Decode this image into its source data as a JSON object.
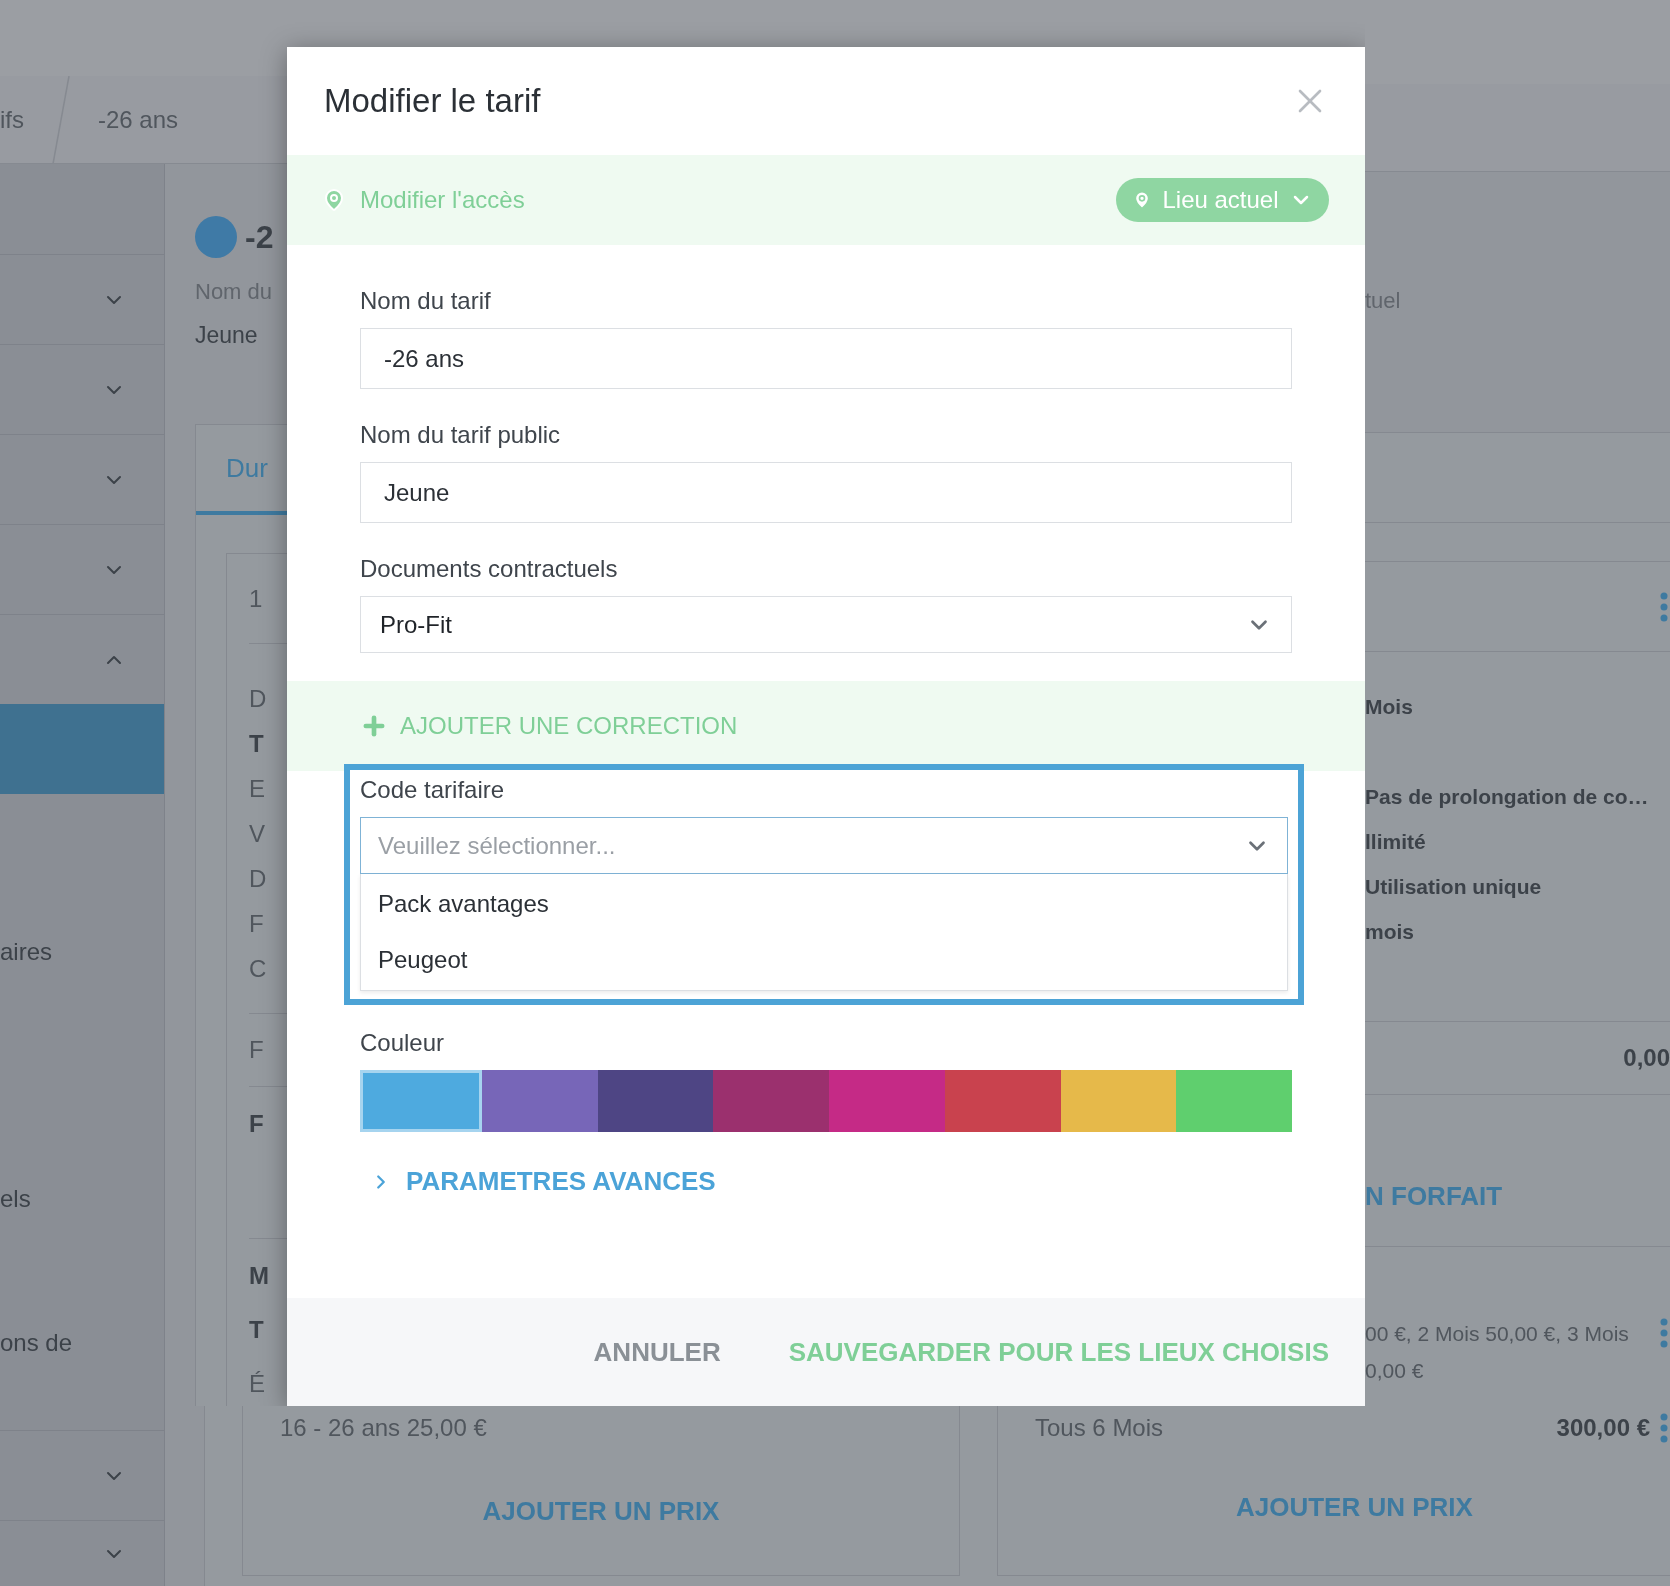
{
  "background": {
    "breadcrumb": [
      "ifs",
      "-26 ans"
    ],
    "sidebar_top": [
      {
        "kind": "group",
        "expanded": false
      },
      {
        "kind": "group",
        "expanded": false
      },
      {
        "kind": "group",
        "expanded": false
      },
      {
        "kind": "group",
        "expanded": false
      },
      {
        "kind": "group",
        "expanded": true
      },
      {
        "kind": "link",
        "selected": true
      },
      {
        "kind": "link",
        "label": "aires",
        "selected": false
      },
      {
        "kind": "link",
        "label": "els",
        "selected": false
      },
      {
        "kind": "link",
        "label": "ons de",
        "selected": false
      }
    ],
    "sidebar_bottom": [
      {
        "kind": "group",
        "expanded": false
      },
      {
        "kind": "group",
        "expanded": false
      }
    ],
    "header": {
      "title": "-2",
      "subtitle": "Nom du",
      "value": "Jeune",
      "right_subtitle": "tuel"
    },
    "tab": "Dur",
    "left_card": {
      "header": "1",
      "sections": [
        [
          {
            "text": "D",
            "bold": false
          },
          {
            "text": "T",
            "bold": true
          },
          {
            "text": "E",
            "bold": false
          },
          {
            "text": "V",
            "bold": false
          },
          {
            "text": "D",
            "bold": false
          },
          {
            "text": "F",
            "bold": false
          },
          {
            "text": "C",
            "bold": false
          }
        ],
        [
          {
            "text": "F",
            "bold": false
          }
        ],
        [
          {
            "text": "F",
            "bold": true
          }
        ],
        [
          {
            "text": "M",
            "bold": true
          },
          {
            "text": "T",
            "bold": true
          },
          {
            "text": "É",
            "bold": false
          }
        ]
      ],
      "footer_text": "16 - 26 ans 25,00 €",
      "button": "AJOUTER UN PRIX"
    },
    "right_card": {
      "sections": [
        [
          {
            "text": "Mois",
            "bold": true
          },
          {
            "text": "Pas de prolongation de co…",
            "bold": true
          },
          {
            "text": "llimité",
            "bold": true
          },
          {
            "text": "Utilisation unique",
            "bold": true
          },
          {
            "text": "mois",
            "bold": true
          }
        ],
        [
          {
            "text": "0,00",
            "bold": true
          }
        ],
        [
          {
            "text": "N FORFAIT",
            "bold": true
          }
        ],
        [
          {
            "text": "00 €, 2 Mois 50,00 €, 3 Mois",
            "bold": false
          },
          {
            "text": "0,00 €",
            "bold": false
          }
        ]
      ],
      "footer_text": "Tous 6 Mois",
      "footer_price": "300,00 €",
      "button": "AJOUTER UN PRIX"
    }
  },
  "modal": {
    "title": "Modifier le tarif",
    "access": {
      "label": "Modifier l'accès",
      "location": "Lieu actuel"
    },
    "fields": [
      {
        "label": "Nom du tarif",
        "kind": "input",
        "value": "-26 ans"
      },
      {
        "label": "Nom du tarif public",
        "kind": "input",
        "value": "Jeune"
      },
      {
        "label": "Documents contractuels",
        "kind": "select",
        "value": "Pro-Fit"
      }
    ],
    "add_correction": "AJOUTER UNE CORRECTION",
    "code": {
      "label": "Code tarifaire",
      "placeholder": "Veuillez sélectionner...",
      "expanded": true,
      "options": [
        "Pack avantages",
        "Peugeot"
      ]
    },
    "color": {
      "label": "Couleur",
      "swatches": [
        {
          "color": "#4eaadf",
          "selected": true
        },
        {
          "color": "#7766b8",
          "selected": false
        },
        {
          "color": "#4e4584",
          "selected": false
        },
        {
          "color": "#9b306e",
          "selected": false
        },
        {
          "color": "#c52a86",
          "selected": false
        },
        {
          "color": "#c9424e",
          "selected": false
        },
        {
          "color": "#e6b94a",
          "selected": false
        },
        {
          "color": "#5fcf6e",
          "selected": false
        }
      ]
    },
    "advanced": "PARAMETRES AVANCES",
    "buttons": {
      "cancel": "ANNULER",
      "save": "SAUVEGARDER POUR LES LIEUX CHOISIS"
    }
  }
}
